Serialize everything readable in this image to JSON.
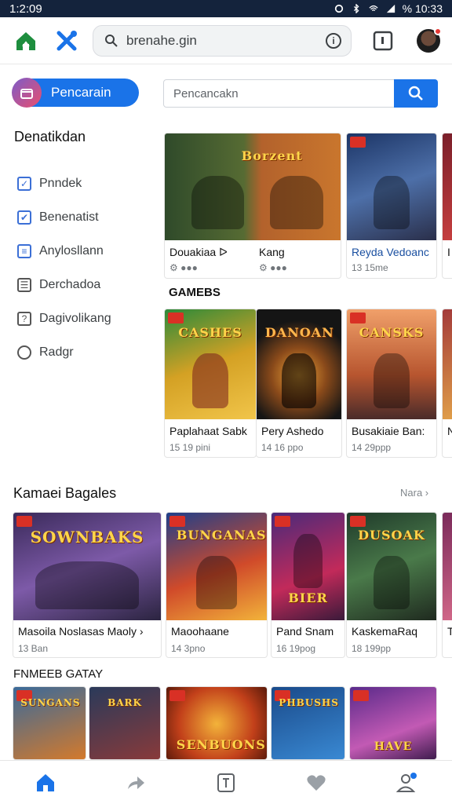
{
  "status_bar": {
    "time": "1:2:09",
    "battery": "% 10:33"
  },
  "browser": {
    "url": "brenahe.gin",
    "info_icon": "info-icon"
  },
  "sidebar": {
    "button_label": "Pencarain",
    "title": "Denatikdan",
    "items": [
      {
        "label": "Pnndek",
        "icon": "checkbox-icon"
      },
      {
        "label": "Benenatist",
        "icon": "checked-icon"
      },
      {
        "label": "Anylosllann",
        "icon": "list-icon"
      },
      {
        "label": "Derchadoa",
        "icon": "document-icon"
      },
      {
        "label": "Dagivolikang",
        "icon": "tag-icon"
      },
      {
        "label": "Radgr",
        "icon": "chat-icon"
      }
    ]
  },
  "search": {
    "placeholder": "Pencancakn"
  },
  "featured_row1": [
    {
      "title": "Douakiaa ᐅ",
      "meta": "⚙ ●●●",
      "logo": "Borzent"
    },
    {
      "title": "Kang",
      "meta": "⚙ ●●●",
      "logo": ""
    },
    {
      "title": "Reyda Vedoanc",
      "meta": "13 15me",
      "logo": ""
    },
    {
      "title": "I",
      "meta": ""
    }
  ],
  "section_games": "GAMEBS",
  "featured_row2": [
    {
      "title": "Paplahaat Sabk",
      "meta": "15 19 pini",
      "logo": "CASHES"
    },
    {
      "title": "Pery Ashedo",
      "meta": "14 16 ppo",
      "logo": "DANOAN"
    },
    {
      "title": "Busakiaie Ban:",
      "meta": "14 29ppp",
      "logo": "CANSKS"
    },
    {
      "title": "N",
      "meta": ""
    }
  ],
  "section_kameri": {
    "title": "Kamaei Bagales",
    "more": "Nara ›"
  },
  "row3": [
    {
      "title": "Masoila Noslasas Maoly ›",
      "meta": "13 Ban",
      "logo": "SOWNBAKS"
    },
    {
      "title": "Maoohaane",
      "meta": "14 3pno",
      "logo": "BUNGANAS"
    },
    {
      "title": "Pand Snam",
      "meta": "16 19pog",
      "logo": "BIER"
    },
    {
      "title": "KaskemaRaq",
      "meta": "18 199pp",
      "logo": "DUSOAK"
    },
    {
      "title": "Tr",
      "meta": ""
    }
  ],
  "section_fnmeer": "FNMEEB GATAY",
  "row4": [
    {
      "logo": "SUNGANS"
    },
    {
      "logo": "BARK"
    },
    {
      "logo": "SENBUONS"
    },
    {
      "logo": "PHBUSHS"
    },
    {
      "logo": "HAVE"
    }
  ],
  "bottom_nav": [
    "home-icon",
    "share-icon",
    "library-icon",
    "favorite-icon",
    "profile-icon"
  ],
  "colors": {
    "accent": "#1a73e8",
    "statusbar": "#14233c"
  }
}
